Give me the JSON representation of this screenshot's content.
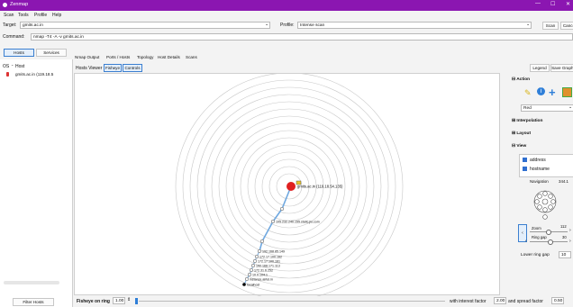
{
  "title_bar": {
    "title": "Zenmap",
    "minimize": "—",
    "maximize": "☐",
    "close": "✕"
  },
  "menu": [
    "Scan",
    "Tools",
    "Profile",
    "Help"
  ],
  "target": {
    "label": "Target:",
    "value": "gmits.ac.in"
  },
  "profile": {
    "label": "Profile:",
    "value": "Intense scan"
  },
  "scan_button": "Scan",
  "cancel_button": "Cancel",
  "command": {
    "label": "Command:",
    "value": "nmap -T4 -A -v gmits.ac.in"
  },
  "side_tabs": [
    "Hosts",
    "Services"
  ],
  "host_list": {
    "col_os": "OS",
    "col_host": "Host",
    "hosts": [
      "gmits.ac.in (119.18.5"
    ]
  },
  "filter_button": "Filter Hosts",
  "main_tabs": [
    "Nmap Output",
    "Ports / Hosts",
    "Topology",
    "Host Details",
    "Scans"
  ],
  "viewer": {
    "hosts_viewer": "Hosts Viewer",
    "fisheye": "Fisheye",
    "controls": "Controls"
  },
  "right_buttons": {
    "legend": "Legend",
    "save_graphic": "Save Graphic"
  },
  "action": {
    "title": "Action",
    "select_value": "Red"
  },
  "sections": {
    "interpolation": "Interpolation",
    "layout": "Layout",
    "view": "View"
  },
  "view_options": [
    {
      "label": "address",
      "checked": true
    },
    {
      "label": "hostname",
      "checked": true
    }
  ],
  "navigation": {
    "label": "Navigation",
    "angle": "344.1"
  },
  "zoom": {
    "label": "Zoom",
    "value": "112"
  },
  "ring_gap": {
    "label": "Ring gap",
    "value": "30"
  },
  "lower_ring_gap": {
    "label": "Lower ring gap",
    "value": "10"
  },
  "fisheye_bar": {
    "label": "Fisheye on ring",
    "value": "1.00",
    "interest_label": "with interest factor",
    "interest": "2.00",
    "spread_label": "and spread factor",
    "spread": "0.50"
  },
  "nodes": [
    {
      "label": "gmits.ac.in (119.18.54.135)"
    },
    {
      "label": ""
    },
    {
      "label": "105.232.240.155.static.jio.com"
    },
    {
      "label": ""
    },
    {
      "label": "192.168.85.149"
    },
    {
      "label": "172.17.100.162"
    },
    {
      "label": "172.17.100.161"
    },
    {
      "label": "192.168.171.113"
    },
    {
      "label": "172.31.6.252"
    },
    {
      "label": "10.0.104.1"
    },
    {
      "label": "instance.airtel.in"
    },
    {
      "label": "localhost"
    }
  ],
  "colors": {
    "title_bar": "#8b16b1",
    "node_target": "#e02020",
    "node_line": "#6fa8e0"
  }
}
